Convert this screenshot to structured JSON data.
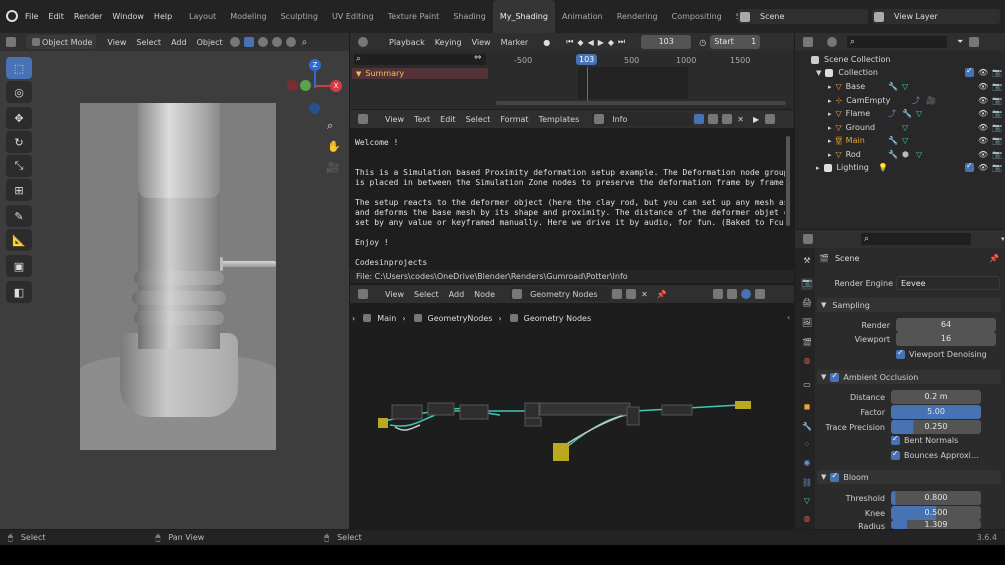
{
  "topbar": {
    "menus": [
      "File",
      "Edit",
      "Render",
      "Window",
      "Help"
    ],
    "workspaces": [
      "Layout",
      "Modeling",
      "Sculpting",
      "UV Editing",
      "Texture Paint",
      "Shading",
      "My_Shading",
      "Animation",
      "Rendering",
      "Compositing",
      "Scripting"
    ],
    "active_workspace": "My_Shading",
    "scene": "Scene",
    "view_layer": "View Layer"
  },
  "viewport": {
    "mode": "Object Mode",
    "menus": [
      "View",
      "Select",
      "Add",
      "Object"
    ],
    "gizmo_z": "Z",
    "gizmo_x": "X"
  },
  "timeline": {
    "menus": [
      "Playback",
      "Keying",
      "View",
      "Marker"
    ],
    "current_frame": "103",
    "start_label": "Start",
    "start_value": "1",
    "summary": "Summary",
    "ruler": [
      "-500",
      "0",
      "103",
      "500",
      "1000",
      "1500"
    ]
  },
  "text_editor": {
    "menus": [
      "View",
      "Text",
      "Edit",
      "Select",
      "Format",
      "Templates"
    ],
    "file": "Info",
    "lines": [
      "Welcome !",
      "",
      "",
      "This is a Simulation based Proximity deformation setup example. The Deformation node group",
      "is placed in between the Simulation Zone nodes to preserve the deformation frame by frame.",
      "",
      "The setup reacts to the deformer object (here the clay rod, but you can set up any mesh as",
      "and deforms the base mesh by its shape and proximity. The distance of the deformer objet ca",
      "set by any value or keyframed manually. Here we drive it by audio, for fun. (Baked to Fcurv",
      "",
      "Enjoy !",
      "",
      "Codesinprojects"
    ],
    "footer": "File: C:\\Users\\codes\\OneDrive\\Blender\\Renders\\Gumroad\\Potter\\Info"
  },
  "node_editor": {
    "menus": [
      "View",
      "Select",
      "Add",
      "Node"
    ],
    "tree_type": "Geometry Nodes",
    "breadcrumb": [
      "Main",
      "GeometryNodes",
      "Geometry Nodes"
    ]
  },
  "outliner": {
    "root": "Scene Collection",
    "collection": "Collection",
    "items": [
      "Base",
      "CamEmpty",
      "Flame",
      "Ground",
      "Main",
      "Rod"
    ],
    "active_item": "Main",
    "lighting": "Lighting"
  },
  "properties": {
    "scene": "Scene",
    "render_engine_label": "Render Engine",
    "render_engine": "Eevee",
    "sampling": {
      "title": "Sampling",
      "render_label": "Render",
      "render": "64",
      "viewport_label": "Viewport",
      "viewport": "16",
      "denoise": "Viewport Denoising"
    },
    "ao": {
      "title": "Ambient Occlusion",
      "distance_label": "Distance",
      "distance": "0.2 m",
      "factor_label": "Factor",
      "factor": "5.00",
      "precision_label": "Trace Precision",
      "precision": "0.250",
      "bent": "Bent Normals",
      "bounces": "Bounces Approxi..."
    },
    "bloom": {
      "title": "Bloom",
      "threshold_label": "Threshold",
      "threshold": "0.800",
      "knee_label": "Knee",
      "knee": "0.500",
      "radius_label": "Radius",
      "radius": "1.309"
    }
  },
  "statusbar": {
    "left": "Select",
    "mid": "Pan View",
    "right": "Select",
    "version": "3.6.4"
  },
  "colors": {
    "accent": "#4772b3",
    "active_orange": "#e8a33a",
    "node_teal": "#3fc9b4"
  }
}
